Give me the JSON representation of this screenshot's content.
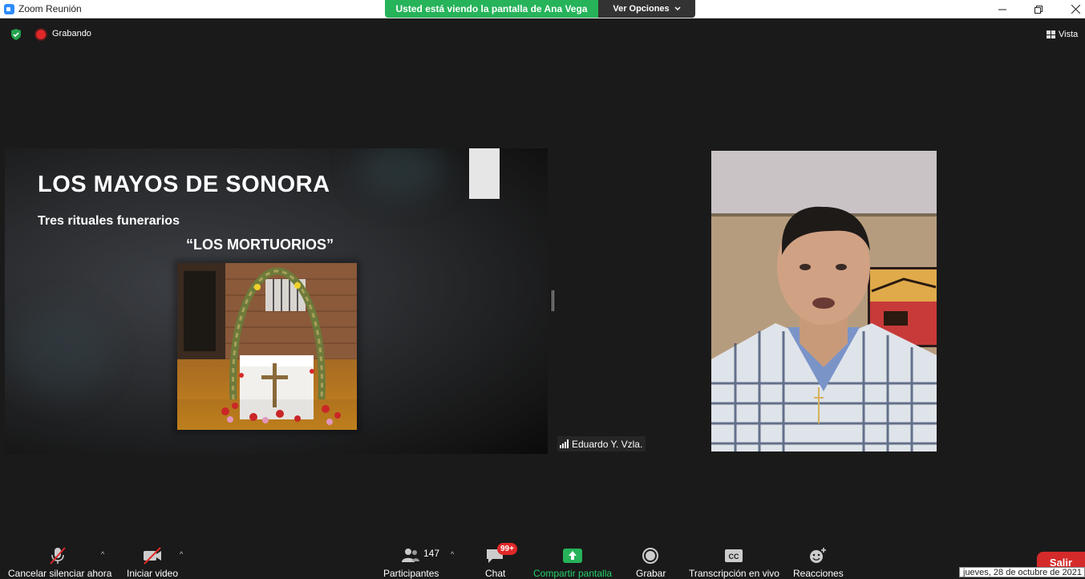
{
  "window": {
    "title": "Zoom Reunión"
  },
  "banner": {
    "viewing_text": "Usted está viendo la pantalla de Ana Vega",
    "options_label": "Ver Opciones"
  },
  "status": {
    "recording_label": "Grabando",
    "view_label": "Vista"
  },
  "slide": {
    "title": "LOS MAYOS DE SONORA",
    "subtitle": "Tres rituales funerarios",
    "subtitle2": "“LOS MORTUORIOS”"
  },
  "participant": {
    "name": "Eduardo Y. Vzla."
  },
  "toolbar": {
    "mute_label": "Cancelar silenciar ahora",
    "video_label": "Iniciar video",
    "participants_label": "Participantes",
    "participants_count": "147",
    "chat_label": "Chat",
    "chat_badge": "99+",
    "share_label": "Compartir pantalla",
    "record_label": "Grabar",
    "transcript_label": "Transcripción en vivo",
    "reactions_label": "Reacciones",
    "leave_label": "Salir"
  },
  "tooltip": {
    "date": "jueves, 28 de octubre de 2021"
  },
  "colors": {
    "share_green": "#26b35a",
    "leave_red": "#d42a2a",
    "rec_red": "#e02828"
  },
  "icons": [
    "zoom-app-icon",
    "shield-icon",
    "record-dot-icon",
    "grid-view-icon",
    "microphone-muted-icon",
    "camera-off-icon",
    "participants-icon",
    "chat-icon",
    "share-screen-icon",
    "record-icon",
    "cc-icon",
    "reaction-icon",
    "signal-bars-icon",
    "chevron-down-icon"
  ]
}
